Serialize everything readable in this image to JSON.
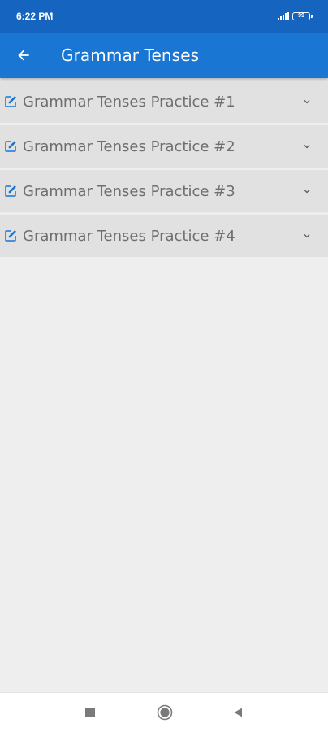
{
  "status_bar": {
    "time": "6:22 PM",
    "battery_level": "99",
    "icons": [
      "signal-icon",
      "battery-icon"
    ]
  },
  "app_bar": {
    "title": "Grammar Tenses",
    "back_icon": "arrow-back-icon"
  },
  "practice_list": {
    "items": [
      {
        "label": "Grammar Tenses Practice #1",
        "icon": "edit-icon",
        "trailing_icon": "chevron-down-icon"
      },
      {
        "label": "Grammar Tenses Practice #2",
        "icon": "edit-icon",
        "trailing_icon": "chevron-down-icon"
      },
      {
        "label": "Grammar Tenses Practice #3",
        "icon": "edit-icon",
        "trailing_icon": "chevron-down-icon"
      },
      {
        "label": "Grammar Tenses Practice #4",
        "icon": "edit-icon",
        "trailing_icon": "chevron-down-icon"
      }
    ]
  },
  "nav_bar": {
    "buttons": [
      "recents-square-icon",
      "home-circle-icon",
      "back-triangle-icon"
    ]
  },
  "colors": {
    "status_bar": "#1565c0",
    "app_bar": "#1976d2",
    "item_background": "#e1e1e1",
    "item_text": "#6e6e6e",
    "edit_icon": "#1976d2",
    "page_background": "#eeeeee"
  }
}
